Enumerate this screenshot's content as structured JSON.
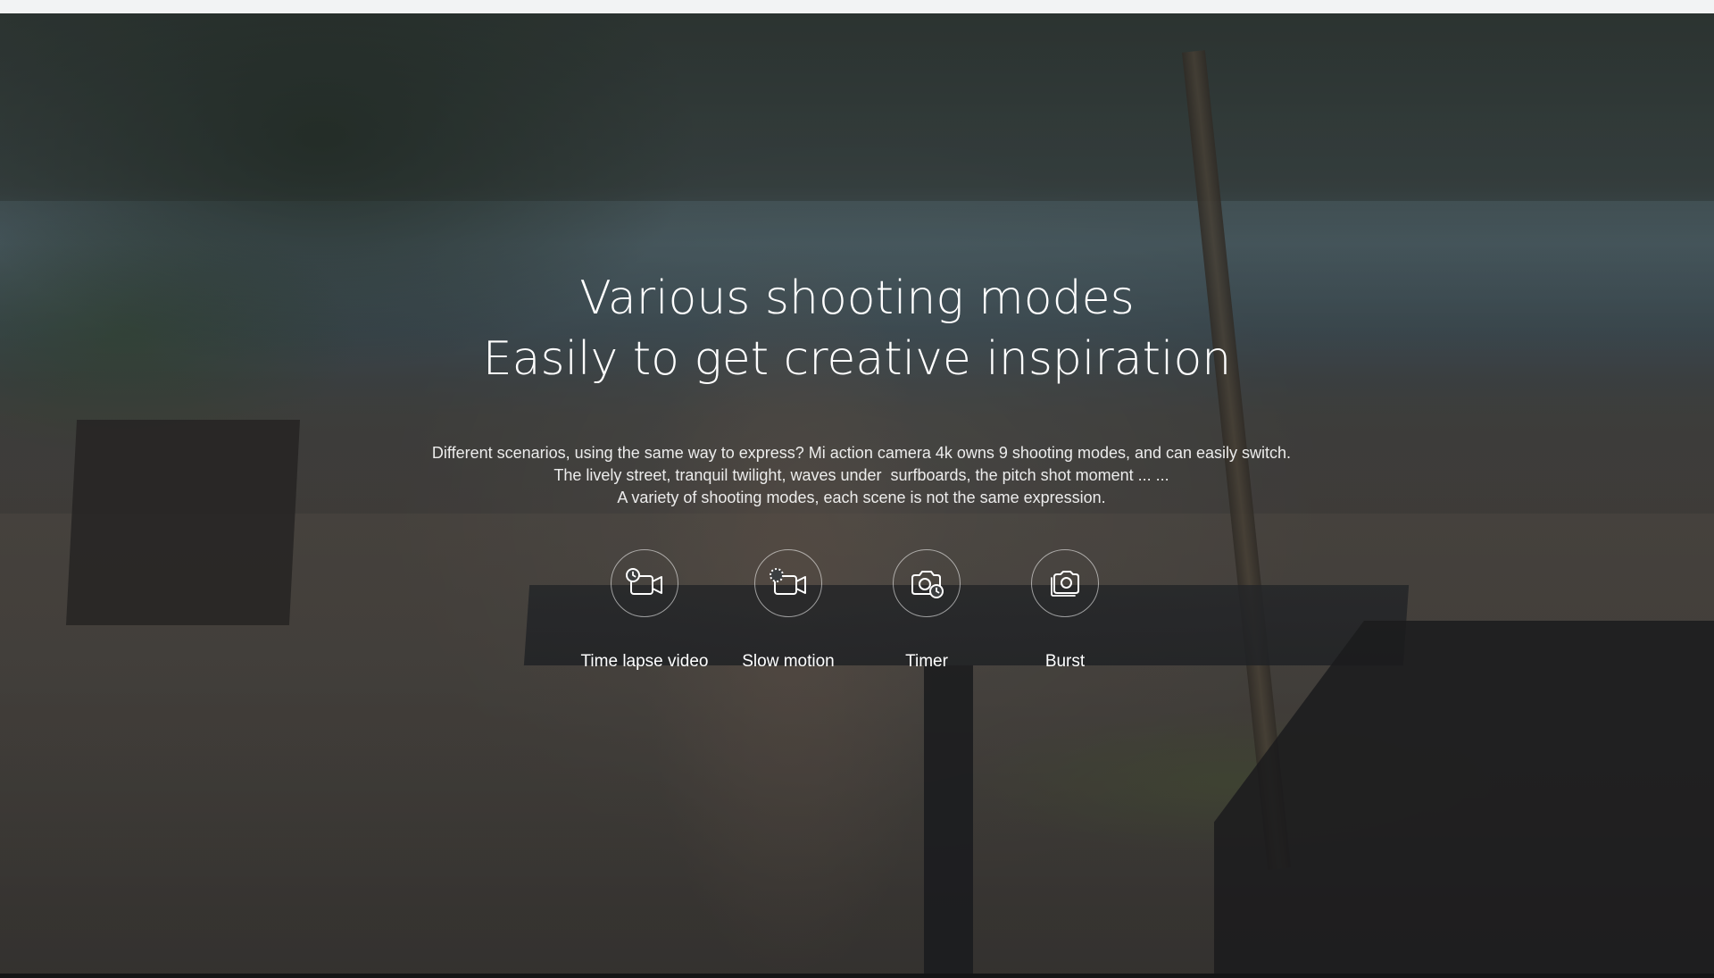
{
  "hero": {
    "headline": {
      "line1": "Various shooting modes",
      "line2": "Easily to get creative inspiration"
    },
    "description": {
      "line1": "Different scenarios, using the same way to express? Mi action camera 4k owns 9 shooting modes, and can easily switch.",
      "line2": "The lively street, tranquil twilight, waves under  surfboards, the pitch shot moment ... ...",
      "line3": "A variety of shooting modes, each scene is not the same expression."
    },
    "modes": [
      {
        "label": "Time lapse video",
        "icon": "time-lapse-video-icon"
      },
      {
        "label": "Slow motion",
        "icon": "slow-motion-icon"
      },
      {
        "label": "Timer",
        "icon": "timer-icon"
      },
      {
        "label": "Burst",
        "icon": "burst-icon"
      }
    ]
  },
  "colors": {
    "text": "#ffffff",
    "icon_ring": "#ffffff",
    "top_strip": "#f2f3f4"
  }
}
